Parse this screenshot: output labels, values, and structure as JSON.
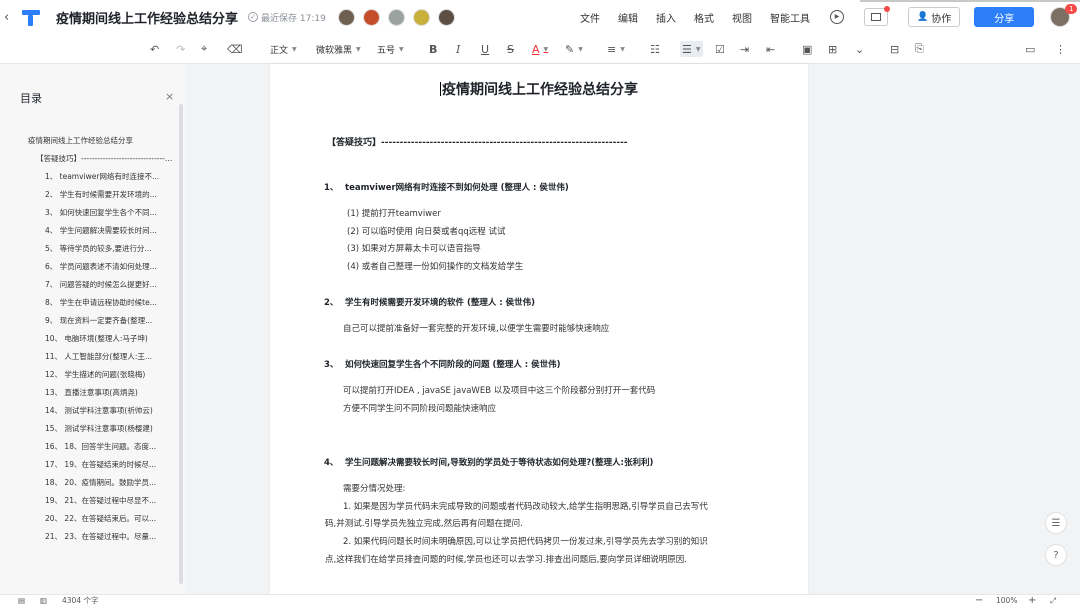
{
  "titlebar": {
    "back_glyph": "‹",
    "title": "疫情期间线上工作经验总结分享",
    "saved": "最近保存 17:19",
    "menus": [
      "文件",
      "编辑",
      "插入",
      "格式",
      "视图",
      "智能工具"
    ],
    "collab": "协作",
    "share": "分享",
    "notify_count": "1",
    "avatar_colors": [
      "#6f5f50",
      "#c44d2a",
      "#9aa3a0",
      "#c9b03a",
      "#5d4e44"
    ]
  },
  "toolbar": {
    "style": "正文",
    "font": "微软雅黑",
    "size": "五号"
  },
  "sidebar": {
    "title": "目录",
    "close": "×",
    "items": [
      {
        "level": 0,
        "text": "疫情期间线上工作经验总结分享"
      },
      {
        "level": 1,
        "text": "【答疑技巧】-----------------------------------------------"
      },
      {
        "level": 2,
        "text": "1、 teamviwer网络有时连接不..."
      },
      {
        "level": 2,
        "text": "2、 学生有时候需要开发环境的..."
      },
      {
        "level": 2,
        "text": "3、 如何快速回复学生各个不同..."
      },
      {
        "level": 2,
        "text": "4、 学生问题解决需要较长时间..."
      },
      {
        "level": 2,
        "text": "5、 等待学员的较多,要进行分..."
      },
      {
        "level": 2,
        "text": "6、 学员问题表述不清如何处理..."
      },
      {
        "level": 2,
        "text": "7、 问题答疑的时候怎么提更好..."
      },
      {
        "level": 2,
        "text": "8、 学生在申请远程协助时候te..."
      },
      {
        "level": 2,
        "text": "9、 现在资料一定要齐备(整理..."
      },
      {
        "level": 2,
        "text": "10、 电脑环境(整理人:马子坤)"
      },
      {
        "level": 2,
        "text": "11、 人工智能部分(整理人:王..."
      },
      {
        "level": 2,
        "text": "12、 学生描述的问题(张晓梅)"
      },
      {
        "level": 2,
        "text": "13、 直播注意事项(高炳尧)"
      },
      {
        "level": 2,
        "text": "14、 测试学科注意事项(祈帅云)"
      },
      {
        "level": 2,
        "text": "15、 测试学科注意事项(杨樱建)"
      },
      {
        "level": 2,
        "text": "16、 18、回答学生问题。态度..."
      },
      {
        "level": 2,
        "text": "17、 19、在答疑结束的时候尽..."
      },
      {
        "level": 2,
        "text": "18、 20、疫情期间。鼓励学员..."
      },
      {
        "level": 2,
        "text": "19、 21、在答疑过程中尽显不..."
      },
      {
        "level": 2,
        "text": "20、 22、在答疑结束后。可以..."
      },
      {
        "level": 2,
        "text": "21、 23、在答疑过程中。尽量..."
      }
    ]
  },
  "document": {
    "title": "疫情期间线上工作经验总结分享",
    "section": "【答疑技巧】------------------------------------------------------------------",
    "h1_num": "1、",
    "h1": "teamviwer网络有时连接不到如何处理 (整理人 : 侯世伟)",
    "h1_items": [
      "(1) 提前打开teamviwer",
      "(2) 可以临时使用 向日葵或者qq远程 试试",
      "(3) 如果对方屏幕太卡可以语音指导",
      "(4) 或者自己整理一份如何操作的文档发给学生"
    ],
    "h2_num": "2、",
    "h2": "学生有时候需要开发环境的软件 (整理人 : 侯世伟)",
    "h2_para": "自己可以提前准备好一套完整的开发环境,以便学生需要时能够快速响应",
    "h3_num": "3、",
    "h3": "如何快速回复学生各个不同阶段的问题 (整理人 : 侯世伟)",
    "h3_para1": "可以提前打开IDEA , javaSE javaWEB 以及项目中这三个阶段都分别打开一套代码",
    "h3_para2": "方便不同学生问不同阶段问题能快速响应",
    "h4_num": "4、",
    "h4": "学生问题解决需要较长时间,导致别的学员处于等待状态如何处理?(整理人:张利利)",
    "h4_p0": "需要分情况处理:",
    "h4_p1a": "1. 如果是因为学员代码未完成导致的问题或者代码改动较大,给学生指明思路,引导学员自己去写代",
    "h4_p1b": "码,并测试.引导学员先独立完成,然后再有问题在提问.",
    "h4_p2a": "2. 如果代码问题长时间未明确原因,可以让学员把代码拷贝一份发过来,引导学员先去学习别的知识",
    "h4_p2b": "点,这样我们在给学员排查问题的时候,学员也还可以去学习.排查出问题后,要向学员详细说明原因."
  },
  "floating": {
    "help": "?"
  },
  "status": {
    "word_count": "4304 个字",
    "zoom": "100%",
    "minus": "−",
    "plus": "+"
  }
}
